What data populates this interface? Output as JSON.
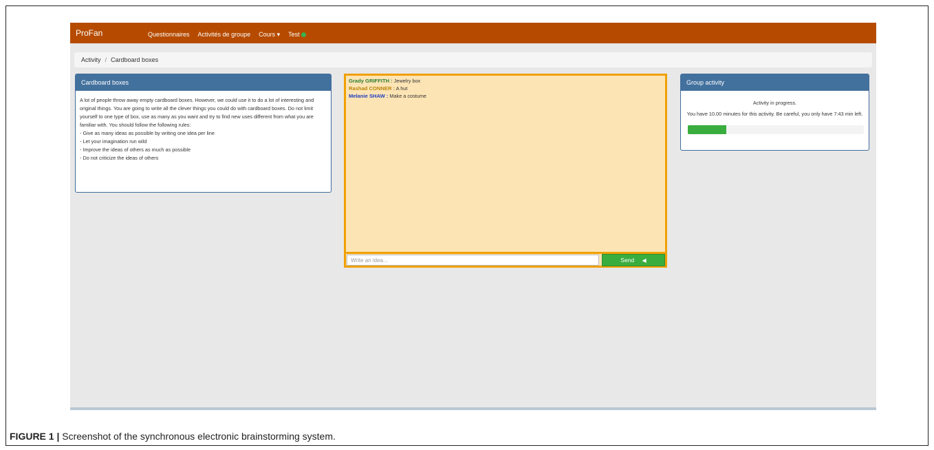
{
  "navbar": {
    "brand": "ProFan",
    "items": [
      "Questionnaires",
      "Activités de groupe",
      "Cours ▾",
      "Test"
    ],
    "status_color": "#37b24d"
  },
  "breadcrumb": {
    "items": [
      "Activity",
      "Cardboard boxes"
    ],
    "separator": "/"
  },
  "task_panel": {
    "title": "Cardboard boxes",
    "paragraph": "A lot of people throw away empty cardboard boxes. However, we could use it to do a lot of interesting and original things. You are going to write all the clever things you could do with cardboard boxes. Do not limit yourself to one type of box, use as many as you want and try to find new uses different from what you are familiar with. You should follow the following rules:",
    "rules": [
      "- Give as many ideas as possible by writing one idea per line",
      "- Let your imagination run wild",
      "- Improve the ideas of others as much as possible",
      "- Do not criticize the ideas of others"
    ]
  },
  "chat": {
    "messages": [
      {
        "author": "Grady GRIFFITH :",
        "text": "Jewelry box",
        "color": "#2e7d32"
      },
      {
        "author": "Rashad CONNER :",
        "text": "A hut",
        "color": "#b8860b"
      },
      {
        "author": "Melanie SHAW :",
        "text": "Make a costume",
        "color": "#1f3fbf"
      }
    ],
    "input_placeholder": "Write an idea...",
    "send_label": "Send"
  },
  "group_panel": {
    "title": "Group activity",
    "status": "Activity in progress.",
    "timer_text": "You have 10.00 minutes for this activity. Be careful, you only have 7:43 min left.",
    "progress_fraction": 0.22
  },
  "caption": {
    "label": "FIGURE 1 |",
    "text": " Screenshot of the synchronous electronic brainstorming system."
  },
  "colors": {
    "navbar": "#b64b00",
    "panel_header": "#43719e",
    "chat_background": "#fde4b4",
    "chat_border": "#f0a000",
    "send_button": "#3aad3f"
  }
}
